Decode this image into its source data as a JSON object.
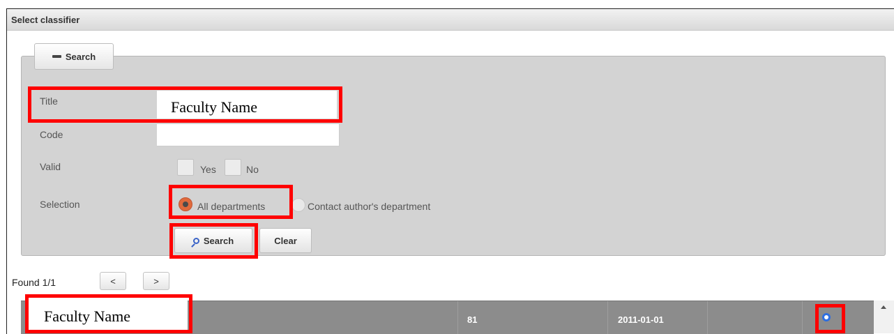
{
  "dialog": {
    "title": "Select classifier"
  },
  "search_toggle": {
    "label": "Search"
  },
  "form": {
    "title_label": "Title",
    "title_value": "Faculty Name",
    "code_label": "Code",
    "code_value": "",
    "valid_label": "Valid",
    "valid_yes": "Yes",
    "valid_no": "No",
    "selection_label": "Selection",
    "selection_all": "All departments",
    "selection_contact": "Contact author's department",
    "search_button": "Search",
    "clear_button": "Clear"
  },
  "results": {
    "found": "Found 1/1",
    "prev": "<",
    "next": ">",
    "rows": [
      {
        "name": "Faculty Name",
        "code": "81",
        "date": "2011-01-01",
        "extra": ""
      }
    ]
  },
  "colors": {
    "highlight": "#ff0000",
    "accent_radio": "#e06a3c",
    "row_bg": "#8c8c8c"
  }
}
